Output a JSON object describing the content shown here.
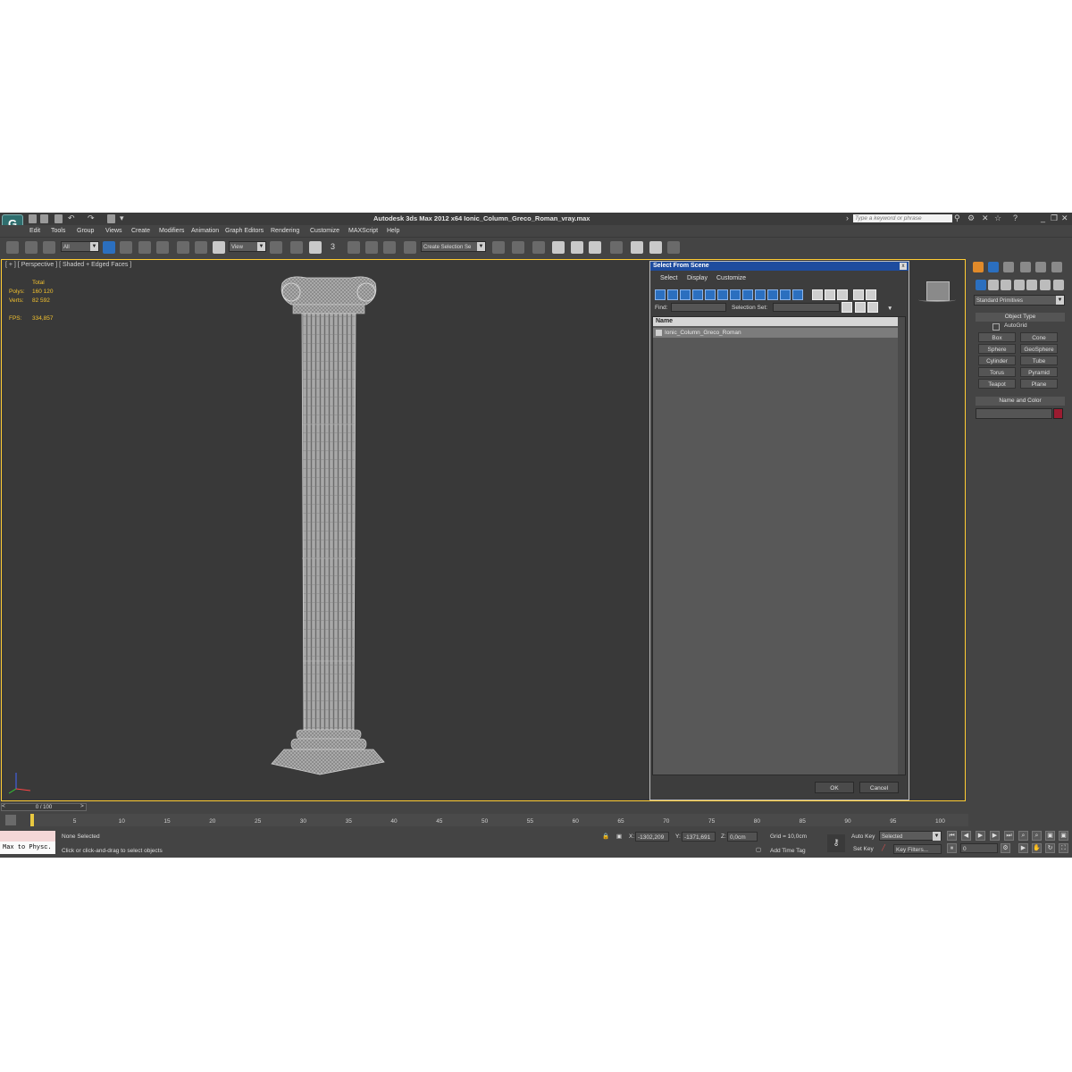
{
  "window": {
    "title": "Autodesk 3ds Max  2012 x64     Ionic_Column_Greco_Roman_vray.max",
    "search_placeholder": "Type a keyword or phrase",
    "app_logo": "G"
  },
  "menu": [
    "Edit",
    "Tools",
    "Group",
    "Views",
    "Create",
    "Modifiers",
    "Animation",
    "Graph Editors",
    "Rendering",
    "Customize",
    "MAXScript",
    "Help"
  ],
  "toolbar": {
    "filter_value": "All",
    "refcoord_value": "View",
    "snap_label": "3",
    "selection_set_placeholder": "Create Selection Se"
  },
  "viewport": {
    "label": "[ + ] [ Perspective ] [ Shaded + Edged Faces ]",
    "stats": {
      "total_label": "Total",
      "polys_label": "Polys:",
      "polys_value": "160 120",
      "verts_label": "Verts:",
      "verts_value": "82 592",
      "fps_label": "FPS:",
      "fps_value": "334,857"
    }
  },
  "dialog": {
    "title": "Select From Scene",
    "close": "x",
    "menu": [
      "Select",
      "Display",
      "Customize"
    ],
    "find_label": "Find:",
    "selection_set_label": "Selection Set:",
    "column_name": "Name",
    "objects": [
      "Ionic_Column_Greco_Roman"
    ],
    "ok": "OK",
    "cancel": "Cancel"
  },
  "command_panel": {
    "dropdown": "Standard Primitives",
    "object_type_title": "Object Type",
    "autogrid": "AutoGrid",
    "primitives": [
      "Box",
      "Cone",
      "Sphere",
      "GeoSphere",
      "Cylinder",
      "Tube",
      "Torus",
      "Pyramid",
      "Teapot",
      "Plane"
    ],
    "name_color_title": "Name and Color",
    "color": "#9b1b30"
  },
  "timeline": {
    "slider": "0 / 100",
    "ticks": [
      "0",
      "5",
      "10",
      "15",
      "20",
      "25",
      "30",
      "35",
      "40",
      "45",
      "50",
      "55",
      "60",
      "65",
      "70",
      "75",
      "80",
      "85",
      "90",
      "95",
      "100"
    ]
  },
  "status": {
    "maxscript": "Max to Physc.",
    "selection": "None Selected",
    "prompt": "Click or click-and-drag to select objects",
    "x_label": "X:",
    "x_value": "-1302,209",
    "y_label": "Y:",
    "y_value": "-1371,691",
    "z_label": "Z:",
    "z_value": "0,0cm",
    "grid": "Grid = 10,0cm",
    "add_time_tag": "Add Time Tag",
    "auto_key": "Auto Key",
    "set_key": "Set Key",
    "selected_option": "Selected",
    "key_filters": "Key Filters...",
    "frame_value": "0"
  }
}
